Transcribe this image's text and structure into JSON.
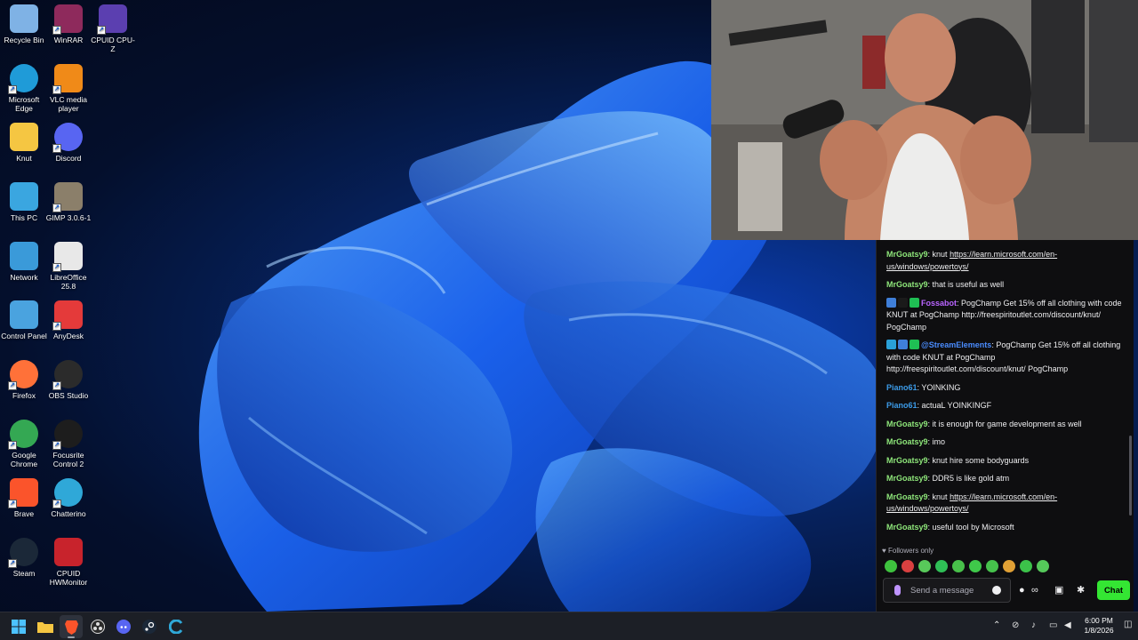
{
  "desktop": {
    "icons": [
      {
        "label": "Recycle Bin",
        "icon": "recycle-bin-icon",
        "color": "#7fb2e5"
      },
      {
        "label": "WinRAR",
        "icon": "winrar-icon",
        "color": "#8e2a5c"
      },
      {
        "label": "CPUID CPU-Z",
        "icon": "cpuz-icon",
        "color": "#5b3fb0"
      },
      {
        "label": "Microsoft Edge",
        "icon": "edge-icon",
        "color": "#1f9bd8"
      },
      {
        "label": "VLC media player",
        "icon": "vlc-icon",
        "color": "#f08a18"
      },
      {
        "label": "Knut",
        "icon": "folder-icon",
        "color": "#f5c642"
      },
      {
        "label": "Discord",
        "icon": "discord-icon",
        "color": "#5865f2"
      },
      {
        "label": "This PC",
        "icon": "monitor-icon",
        "color": "#3aa6e0"
      },
      {
        "label": "GIMP 3.0.6-1",
        "icon": "gimp-icon",
        "color": "#8b7f6a"
      },
      {
        "label": "Network",
        "icon": "network-icon",
        "color": "#3a9ad9"
      },
      {
        "label": "LibreOffice 25.8",
        "icon": "libreoffice-icon",
        "color": "#e8e8e8"
      },
      {
        "label": "Control Panel",
        "icon": "control-panel-icon",
        "color": "#4aa3df"
      },
      {
        "label": "AnyDesk",
        "icon": "anydesk-icon",
        "color": "#e43a3a"
      },
      {
        "label": "Firefox",
        "icon": "firefox-icon",
        "color": "#ff7139"
      },
      {
        "label": "OBS Studio",
        "icon": "obs-icon",
        "color": "#2b2b2b"
      },
      {
        "label": "Google Chrome",
        "icon": "chrome-icon",
        "color": "#34a853"
      },
      {
        "label": "Focusrite Control 2",
        "icon": "focusrite-icon",
        "color": "#1d1d1d"
      },
      {
        "label": "Brave",
        "icon": "brave-icon",
        "color": "#fb542b"
      },
      {
        "label": "Chatterino",
        "icon": "chatterino-icon",
        "color": "#2fa8d8"
      },
      {
        "label": "Steam",
        "icon": "steam-icon",
        "color": "#1b2838"
      },
      {
        "label": "CPUID HWMonitor",
        "icon": "hwmonitor-icon",
        "color": "#c8232c"
      }
    ]
  },
  "chat": {
    "messages": [
      {
        "user": "MrGoatsy9",
        "color": "#8ee67a",
        "badges": [],
        "text": "knut",
        "link": "https://learn.microsoft.com/en-us/windows/powertoys/"
      },
      {
        "user": "MrGoatsy9",
        "color": "#8ee67a",
        "badges": [],
        "text": "that is useful as well",
        "link": ""
      },
      {
        "user": "Fossabot",
        "color": "#b964ff",
        "badges": [
          "#3f7fd9",
          "#1a1a1a",
          "#1fbf54"
        ],
        "text": "PogChamp Get 15% off all clothing with code KNUT at PogChamp http://freespiritoutlet.com/discount/knut/ PogChamp",
        "link": ""
      },
      {
        "user": "@StreamElements",
        "color": "#4a8cff",
        "badges": [
          "#2aa0d8",
          "#3f7fd9",
          "#1fbf54"
        ],
        "text": "PogChamp Get 15% off all clothing with code KNUT at PogChamp http://freespiritoutlet.com/discount/knut/ PogChamp",
        "link": ""
      },
      {
        "user": "Piano61",
        "color": "#3c9be8",
        "badges": [],
        "text": "YOINKING",
        "link": ""
      },
      {
        "user": "Piano61",
        "color": "#3c9be8",
        "badges": [],
        "text": "actuaL YOINKINGF",
        "link": ""
      },
      {
        "user": "MrGoatsy9",
        "color": "#8ee67a",
        "badges": [],
        "text": "it is enough for game development as well",
        "link": ""
      },
      {
        "user": "MrGoatsy9",
        "color": "#8ee67a",
        "badges": [],
        "text": "imo",
        "link": ""
      },
      {
        "user": "MrGoatsy9",
        "color": "#8ee67a",
        "badges": [],
        "text": "knut hire some bodyguards",
        "link": ""
      },
      {
        "user": "MrGoatsy9",
        "color": "#8ee67a",
        "badges": [],
        "text": "DDR5 is like gold atm",
        "link": ""
      },
      {
        "user": "MrGoatsy9",
        "color": "#8ee67a",
        "badges": [],
        "text": "knut",
        "link": "https://learn.microsoft.com/en-us/windows/powertoys/"
      },
      {
        "user": "MrGoatsy9",
        "color": "#8ee67a",
        "badges": [],
        "text": "useful tool by Microsoft",
        "link": ""
      }
    ],
    "followers_only": "Followers only",
    "input_placeholder": "Send a message",
    "send_label": "Chat",
    "emote_colors": [
      "#3ec23e",
      "#d94040",
      "#58c95a",
      "#2fbf56",
      "#48c04a",
      "#3fc84a",
      "#46c24c",
      "#e0a035",
      "#3cc24a",
      "#55c85a"
    ]
  },
  "taskbar": {
    "apps": [
      {
        "icon": "start-icon",
        "active": false
      },
      {
        "icon": "file-explorer-icon",
        "active": false
      },
      {
        "icon": "brave-icon",
        "active": true
      },
      {
        "icon": "obs-icon",
        "active": false
      },
      {
        "icon": "discord-icon",
        "active": false
      },
      {
        "icon": "steam-icon",
        "active": false
      },
      {
        "icon": "chatterino-icon",
        "active": false
      }
    ],
    "time": "6:00 PM",
    "date": "1/8/2026"
  }
}
